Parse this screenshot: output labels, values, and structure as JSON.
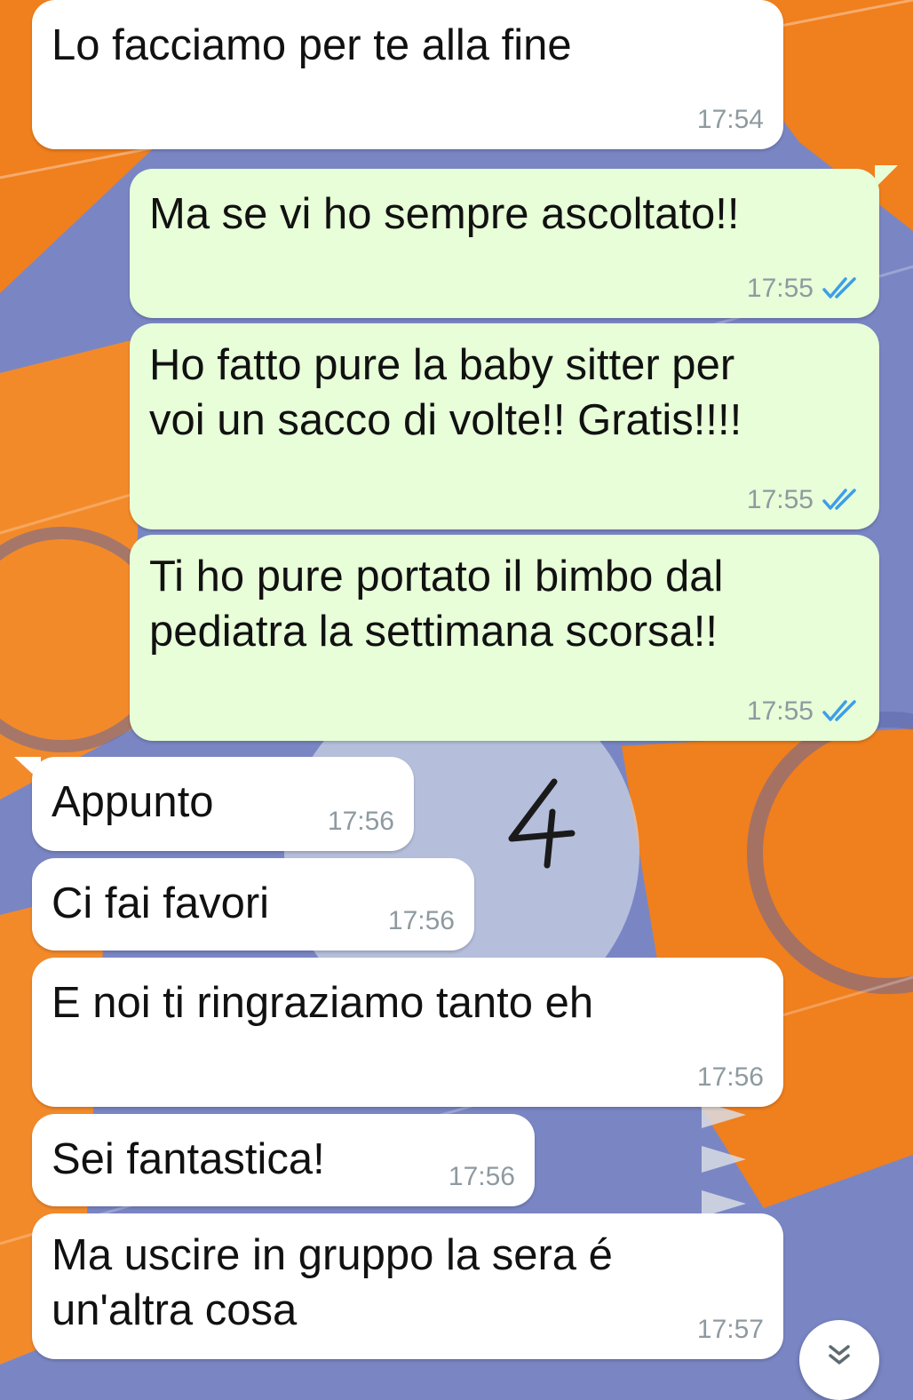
{
  "messages": [
    {
      "direction": "in",
      "text": "Lo facciamo per te alla fine",
      "time": "17:54"
    },
    {
      "direction": "out",
      "text": "Ma se vi ho sempre ascoltato!!",
      "time": "17:55",
      "status": "read"
    },
    {
      "direction": "out",
      "text": "Ho fatto pure la baby sitter per\nvoi un sacco di volte!! Gratis!!!!",
      "time": "17:55",
      "status": "read"
    },
    {
      "direction": "out",
      "text": "Ti ho pure portato il bimbo dal\npediatra la settimana scorsa!!",
      "time": "17:55",
      "status": "read"
    },
    {
      "direction": "in",
      "text": "Appunto",
      "time": "17:56"
    },
    {
      "direction": "in",
      "text": "Ci fai favori",
      "time": "17:56"
    },
    {
      "direction": "in",
      "text": "E noi ti ringraziamo tanto eh",
      "time": "17:56"
    },
    {
      "direction": "in",
      "text": "Sei fantastica!",
      "time": "17:56"
    },
    {
      "direction": "in",
      "text": "Ma uscire in gruppo la sera é\nun'altra cosa",
      "time": "17:57"
    }
  ],
  "annotation": {
    "handwritten_number": "4"
  },
  "colors": {
    "incoming_bubble": "#ffffff",
    "outgoing_bubble": "#e7fed8",
    "timestamp": "#8e9aa0",
    "read_ticks": "#3d9ee8",
    "wallpaper_orange": "#f07f1e",
    "wallpaper_purple": "#7a86c4"
  },
  "icons": {
    "read_receipt": "double-check-icon",
    "scroll_down": "chevron-double-down-icon"
  }
}
